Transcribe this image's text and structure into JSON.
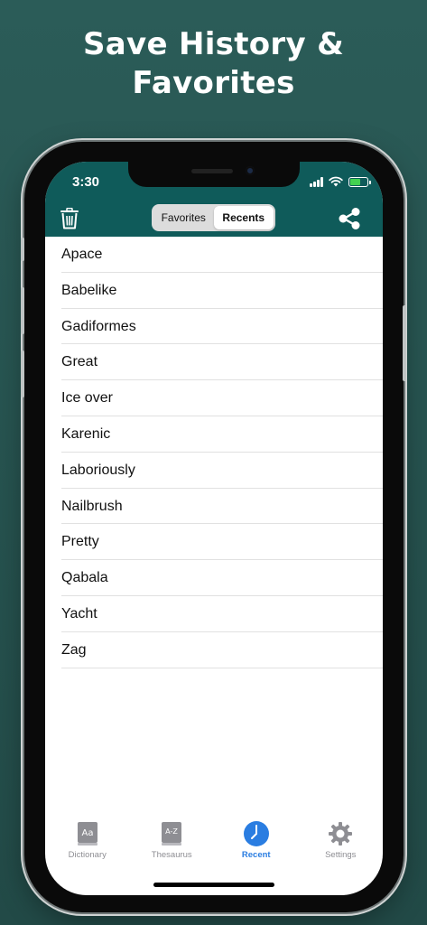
{
  "headline": [
    "Save History &",
    "Favorites"
  ],
  "status_bar": {
    "time": "3:30"
  },
  "toolbar": {
    "segments": [
      {
        "label": "Favorites",
        "selected": false
      },
      {
        "label": "Recents",
        "selected": true
      }
    ],
    "left_icon": "trash-icon",
    "right_icon": "share-icon"
  },
  "recents": [
    "Apace",
    "Babelike",
    "Gadiformes",
    "Great",
    "Ice over",
    "Karenic",
    "Laboriously",
    "Nailbrush",
    "Pretty",
    "Qabala",
    "Yacht",
    "Zag"
  ],
  "tabbar": {
    "items": [
      {
        "label": "Dictionary",
        "icon": "dictionary-icon",
        "glyph": "Aa",
        "active": false
      },
      {
        "label": "Thesaurus",
        "icon": "thesaurus-icon",
        "glyph": "A-Z",
        "active": false
      },
      {
        "label": "Recent",
        "icon": "clock-icon",
        "active": true
      },
      {
        "label": "Settings",
        "icon": "gear-icon",
        "active": false
      }
    ]
  },
  "colors": {
    "background": "#2b5c58",
    "header": "#0f5b5a",
    "accent": "#2a7de1",
    "battery": "#43d150"
  }
}
